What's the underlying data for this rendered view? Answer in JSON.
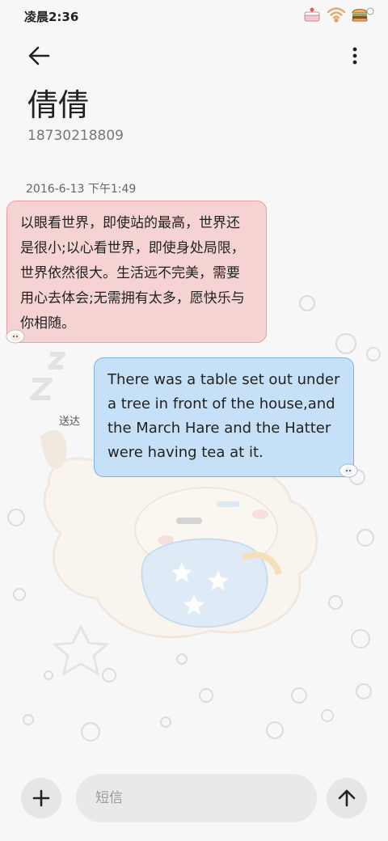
{
  "status_bar": {
    "time": "凌晨2:36",
    "icons": [
      "cake-icon",
      "wifi-icon",
      "burger-battery-icon"
    ]
  },
  "header": {
    "back_icon": "arrow-left-icon",
    "more_icon": "more-vertical-icon",
    "contact_name": "倩倩",
    "phone_number": "18730218809"
  },
  "conversation": {
    "timestamp": "2016-6-13 下午1:49",
    "messages": [
      {
        "direction": "incoming",
        "text": "以眼看世界，即使站的最高，世界还是很小;以心看世界，即使身处局限，世界依然很大。生活远不完美，需要用心去体会;无需拥有太多，愿快乐与你相随。",
        "bubble_color": "#f6d3d3"
      },
      {
        "direction": "outgoing",
        "text": "There was a table set out under a tree in front of the house,and the March Hare and the Hatter were having tea at it.",
        "bubble_color": "#c6e1f7",
        "status": "送达"
      }
    ]
  },
  "composer": {
    "add_icon": "plus-icon",
    "placeholder": "短信",
    "value": "",
    "send_icon": "arrow-up-icon"
  }
}
